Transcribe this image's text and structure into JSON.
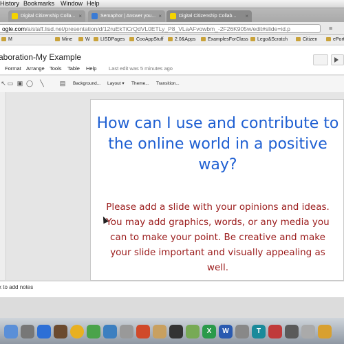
{
  "menubar": {
    "items": [
      "History",
      "Bookmarks",
      "Window",
      "Help"
    ]
  },
  "tabs": [
    {
      "label": "Digital Citizenship Colla...",
      "active": false
    },
    {
      "label": "Semaphor | Answer you...",
      "active": false
    },
    {
      "label": "Digital Citizenship Collab...",
      "active": true
    }
  ],
  "url": {
    "domain": "ogle.com",
    "path": "/a/staff.lisd.net/presentation/d/12ruEkTiCrQdVL0ETLy_P8_VLaAFvowbm_-2F26K905w/edit#slide=id.p"
  },
  "bookmarks": [
    "M",
    "Mine",
    "W",
    "LISDPages",
    "CooAppStuff",
    "2.0&Apps",
    "ExamplesForClass",
    "Lego&Scratch",
    "Citizen",
    "ePort"
  ],
  "doc": {
    "title": "aboration-My Example",
    "menus": [
      "Format",
      "Arrange",
      "Tools",
      "Table",
      "Help"
    ],
    "last_edit": "Last edit was 5 minutes ago"
  },
  "toolbar": {
    "background": "Background...",
    "layout": "Layout",
    "theme": "Theme...",
    "transition": "Transition..."
  },
  "slide": {
    "title": "How can I use and contribute to the online world in a positive way?",
    "body": "Please add a slide with your opinions and ideas.  You may add graphics, words, or any media you can to make your point.  Be creative and make your slide important and visually appealing as well."
  },
  "notes": {
    "placeholder": "k to add notes"
  },
  "colors": {
    "title": "#1e5fd2",
    "body": "#9a1a1a"
  }
}
